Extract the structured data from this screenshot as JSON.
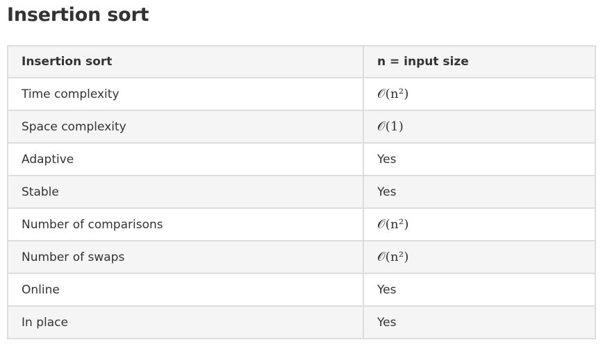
{
  "title": "Insertion sort",
  "table": {
    "headers": [
      "Insertion sort",
      "n = input size"
    ],
    "rows": [
      {
        "property": "Time complexity",
        "value": "𝒪(n²)",
        "math": true
      },
      {
        "property": "Space complexity",
        "value": "𝒪(1)",
        "math": true
      },
      {
        "property": "Adaptive",
        "value": "Yes",
        "math": false
      },
      {
        "property": "Stable",
        "value": "Yes",
        "math": false
      },
      {
        "property": "Number of comparisons",
        "value": "𝒪(n²)",
        "math": true
      },
      {
        "property": "Number of swaps",
        "value": "𝒪(n²)",
        "math": true
      },
      {
        "property": "Online",
        "value": "Yes",
        "math": false
      },
      {
        "property": "In place",
        "value": "Yes",
        "math": false
      }
    ]
  }
}
